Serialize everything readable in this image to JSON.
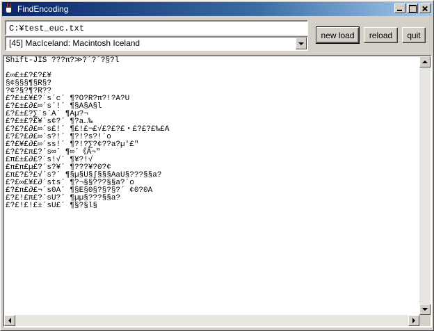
{
  "window": {
    "title": "FindEncoding",
    "icon": "java-cup-icon"
  },
  "file_path": "C:¥test_euc.txt",
  "encoding": {
    "selected": "[45] MacIceland: Macintosh Iceland"
  },
  "buttons": {
    "new_load": "new load",
    "reload": "reload",
    "quit": "quit"
  },
  "output_lines": [
    "Shift-JIS ???π?≫?´?´?§?l",
    "",
    "£∞£±£?£?£¥",
    "§¢§§§¶§R§?",
    "?¢?§?¶?R??",
    "£?£±£¥£?´s´c´ ¶?O?R?π?!?A?U",
    "£?£±£∂£∞´s´!´ ¶§A§A§l",
    "£?£±£?∑´s´A´ ¶Aµ?¬",
    "£?£±£?£¥´s¢?´ ¶?a…‰",
    "£?£?£∂£∞´s£!´ ¶£!£¬£√£?£?£・£?£?£‰£A",
    "£?£?£∂£∞´s?!´ ¶?!?s?!´o",
    "£?£¥£∂£∞´ss!´ ¶?!?∑?¢??a?µ'£\"",
    "£?£?£π£?´s∞´ ¶∞´《A¬\"",
    "£π£±£∂£?´s!√´ ¶¥?!√",
    "£π£π£µ£?´s?¥´ ¶???¥?0?¢",
    "£π£?£?£√´s?´ ¶§µ§U§∫§§§AaU§???§§a?",
    "£?£∞£¥£∂´sts´ ¶?¬§§???§§a?´o",
    "£?£π£∂£¬´s0A´ ¶§E§0§?§?§?´ ¢0?0A",
    "£?£!£π£?´sU?´ ¶µµ§???§§a?",
    "£?£!£!£±´sU£´ ¶§?§l§"
  ]
}
